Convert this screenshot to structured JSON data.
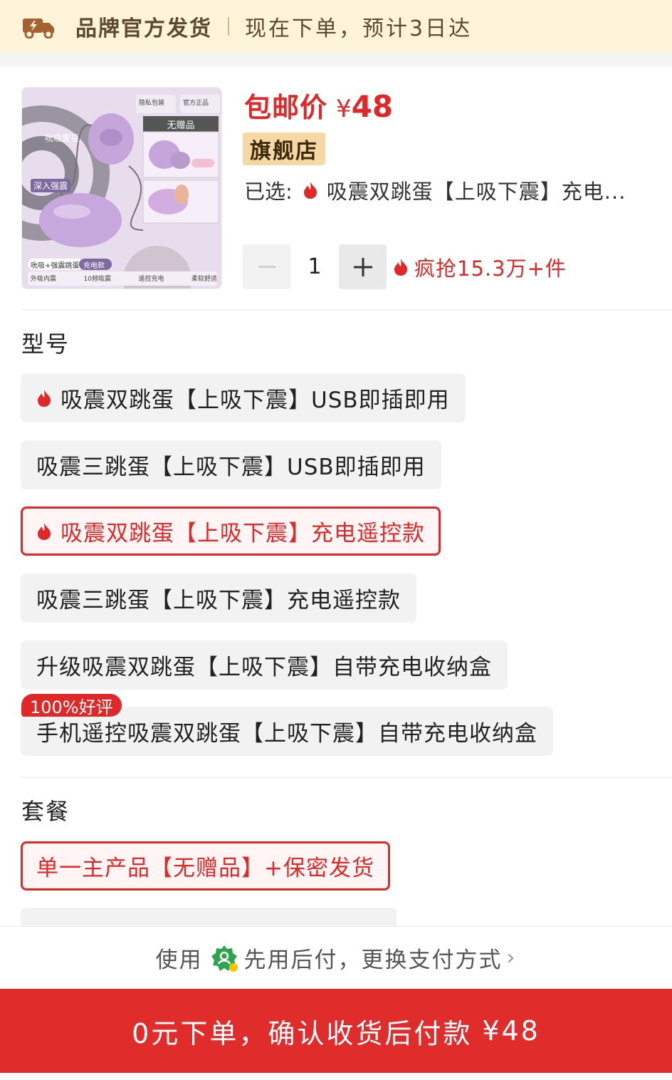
{
  "banner": {
    "icon": "delivery-truck-icon",
    "title": "品牌官方发货",
    "eta": "现在下单，预计3日达"
  },
  "product": {
    "thumbnail": {
      "tag_no_gift": "无赠品",
      "label_suck": "吮吸蜜豆",
      "label_deep": "深入强震",
      "badge_privacy": "隐私包装",
      "badge_official": "官方正品",
      "caption": "吮吸+强震跳蛋",
      "caption_tag": "充电款",
      "features": [
        "外吸内震",
        "10频吸震",
        "遥控充电",
        "柔软舒适"
      ]
    },
    "price_label": "包邮价",
    "currency": "¥",
    "price": "48",
    "store_badge": "旗舰店",
    "selected_label": "已选:",
    "selected_value": "吸震双跳蛋【上吸下震】充电...",
    "quantity": "1",
    "hot_sale": "疯抢15.3万+件"
  },
  "model_section": {
    "title": "型号",
    "options": [
      {
        "label": "吸震双跳蛋【上吸下震】USB即插即用",
        "hot": true,
        "selected": false
      },
      {
        "label": "吸震三跳蛋【上吸下震】USB即插即用",
        "hot": false,
        "selected": false
      },
      {
        "label": "吸震双跳蛋【上吸下震】充电遥控款",
        "hot": true,
        "selected": true
      },
      {
        "label": "吸震三跳蛋【上吸下震】充电遥控款",
        "hot": false,
        "selected": false
      },
      {
        "label": "升级吸震双跳蛋【上吸下震】自带充电收纳盒",
        "hot": false,
        "selected": false
      },
      {
        "label": "手机遥控吸震双跳蛋【上吸下震】自带充电收纳盒",
        "hot": false,
        "selected": false
      }
    ],
    "rating_tag": "100%好评"
  },
  "package_section": {
    "title": "套餐",
    "options": [
      {
        "label": "单一主产品【无赠品】+保密发货",
        "selected": true
      }
    ]
  },
  "pay_bar": {
    "prefix": "使用",
    "method": "先用后付，更换支付方式",
    "icon": "pay-later-badge-icon"
  },
  "cta": {
    "label": "0元下单，确认收货后付款",
    "amount": "¥48"
  },
  "colors": {
    "accent": "#e02828",
    "banner_bg": "#fdf4da",
    "store_badge_bg": "#f6d8a4"
  }
}
